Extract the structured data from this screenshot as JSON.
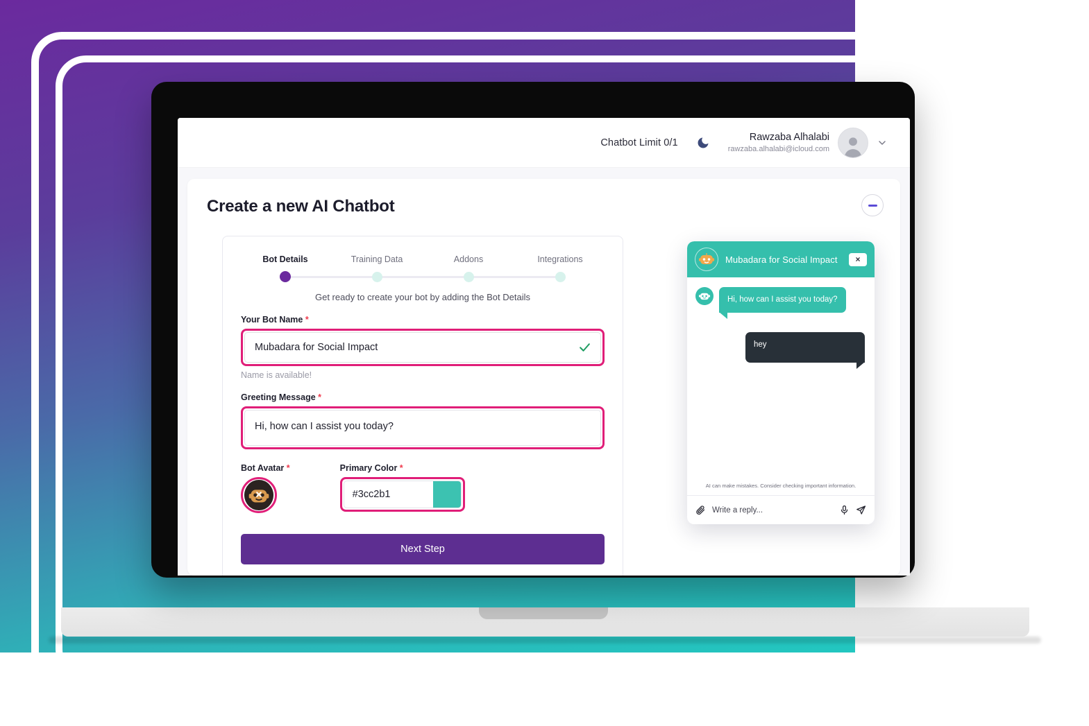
{
  "app": {
    "header": {
      "chatbot_limit": "Chatbot Limit 0/1",
      "theme_toggle_icon": "moon-icon",
      "user_name": "Rawzaba Alhalabi",
      "user_email": "rawzaba.alhalabi@icloud.com",
      "avatar_icon": "user-avatar-icon",
      "chevron_icon": "chevron-down-icon"
    },
    "page": {
      "title": "Create a new AI Chatbot",
      "collapse_icon": "minus-icon"
    },
    "stepper": {
      "steps": [
        {
          "label": "Bot Details",
          "state": "active"
        },
        {
          "label": "Training Data",
          "state": "inactive"
        },
        {
          "label": "Addons",
          "state": "inactive"
        },
        {
          "label": "Integrations",
          "state": "inactive"
        }
      ],
      "hint": "Get ready to create your bot by adding the Bot Details"
    },
    "form": {
      "bot_name": {
        "label": "Your Bot Name",
        "required_mark": "*",
        "value": "Mubadara for Social Impact",
        "placeholder": "Your Bot Name",
        "valid_icon": "check-icon",
        "helper": "Name is available!"
      },
      "greeting_message": {
        "label": "Greeting Message",
        "required_mark": "*",
        "value": "Hi, how can I assist you today?",
        "placeholder": "Greeting Message"
      },
      "bot_avatar": {
        "label": "Bot Avatar",
        "required_mark": "*",
        "icon": "bot-avatar-icon"
      },
      "primary_color": {
        "label": "Primary Color",
        "required_mark": "*",
        "value": "#3cc2b1",
        "swatch_color": "#3cc2b1"
      },
      "submit_label": "Next Step"
    },
    "chat_widget": {
      "title": "Mubadara for Social Impact",
      "close_label": "×",
      "header_avatar_icon": "bot-face-icon",
      "messages": [
        {
          "sender": "bot",
          "text": "Hi, how can I assist you today?",
          "avatar_icon": "bot-face-icon"
        },
        {
          "sender": "user",
          "text": "hey"
        }
      ],
      "copy_icon": "copy-icon",
      "disclaimer": "AI can make mistakes. Consider checking important information.",
      "input_placeholder": "Write a reply...",
      "attach_icon": "paperclip-icon",
      "mic_icon": "microphone-icon",
      "send_icon": "send-icon"
    }
  },
  "theme": {
    "accent_purple": "#5d2e91",
    "accent_teal": "#35bfac",
    "annotation_pink": "#e01e78",
    "step_active": "#6b2a9e",
    "step_inactive": "#d7f2ec",
    "required_red": "#ef3b4e",
    "user_bubble": "#283038"
  }
}
